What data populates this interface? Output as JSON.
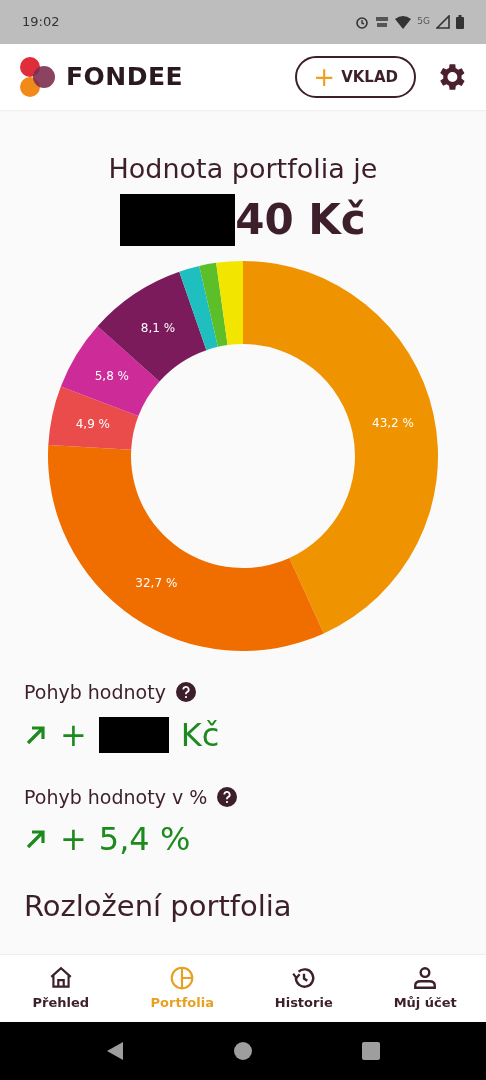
{
  "status_bar": {
    "time": "19:02",
    "network_label": "5G"
  },
  "header": {
    "brand": "FONDEE",
    "deposit_button": {
      "icon": "+",
      "label": "VKLAD"
    }
  },
  "portfolio_value": {
    "title": "Hodnota portfolia je",
    "amount_suffix": "40 Kč"
  },
  "chart_data": {
    "type": "donut",
    "values": [
      43.2,
      32.7,
      4.9,
      5.8,
      8.1,
      1.7,
      1.4,
      2.2
    ],
    "colors": [
      "#ef9300",
      "#f06d00",
      "#e94c4a",
      "#cd2b98",
      "#7c1b5c",
      "#1fbfbf",
      "#5cbf2a",
      "#f2e600"
    ],
    "value_labels": [
      "43,2 %",
      "32,7 %",
      "4,9 %",
      "5,8 %",
      "8,1 %",
      null,
      null,
      null
    ]
  },
  "stats": [
    {
      "label": "Pohyb hodnoty",
      "kind": "up",
      "sign": "+",
      "value_suffix": "Kč",
      "redacted": true
    },
    {
      "label": "Pohyb hodnoty v %",
      "kind": "up",
      "sign": "+",
      "value_suffix": "5,4 %",
      "redacted": false
    }
  ],
  "section_title": "Rozložení portfolia",
  "nav": [
    {
      "label": "Přehled",
      "selected": false
    },
    {
      "label": "Portfolia",
      "selected": true
    },
    {
      "label": "Historie",
      "selected": false
    },
    {
      "label": "Můj účet",
      "selected": false
    }
  ]
}
